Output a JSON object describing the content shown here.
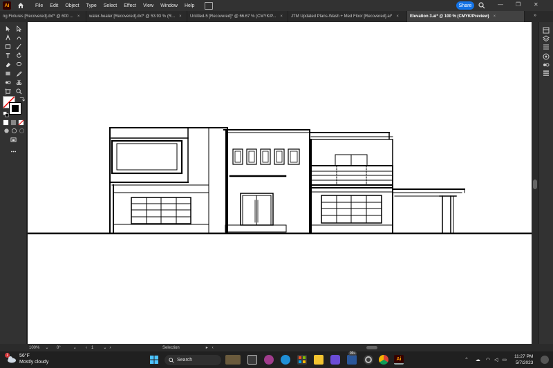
{
  "app": {
    "logo": "Ai",
    "menus": [
      "File",
      "Edit",
      "Object",
      "Type",
      "Select",
      "Effect",
      "View",
      "Window",
      "Help"
    ],
    "share_label": "Share",
    "window_controls": [
      "—",
      "❐",
      "✕"
    ]
  },
  "tabs": [
    {
      "label": "ng Fixtures [Recovered].dxf* @ 600 ...",
      "close": "×",
      "active": false
    },
    {
      "label": "water-heater [Recovered].dxf* @ 53.93 % (R...",
      "close": "×",
      "active": false
    },
    {
      "label": "Untitled-5 [Recovered]* @ 66.67 % (CMYK/P...",
      "close": "×",
      "active": false
    },
    {
      "label": "JTM Updated Plans-Wash + Med Floor [Recovered].ai*",
      "close": "×",
      "active": false
    },
    {
      "label": "Elevation 3.ai* @ 100 % (CMYK/Preview)",
      "close": "×",
      "active": true
    }
  ],
  "tabs_overflow": "»",
  "status": {
    "zoom": "100%",
    "rotation": "0°",
    "artboard": "1",
    "tool": "Selection"
  },
  "taskbar": {
    "weather_temp": "56°F",
    "weather_desc": "Mostly cloudy",
    "weather_badge": "1",
    "search_label": "Search",
    "notif_badge": "99+",
    "time": "11:27 PM",
    "date": "5/7/2023"
  },
  "colors": {
    "ui_bg": "#323232",
    "canvas_bg": "#ffffff",
    "accent": "#1473e6",
    "ai_orange": "#ff9a00"
  },
  "icons": {
    "home": "home-icon",
    "search": "search-icon",
    "selection_tool": "selection-tool-icon",
    "direct_selection_tool": "direct-selection-tool-icon"
  }
}
